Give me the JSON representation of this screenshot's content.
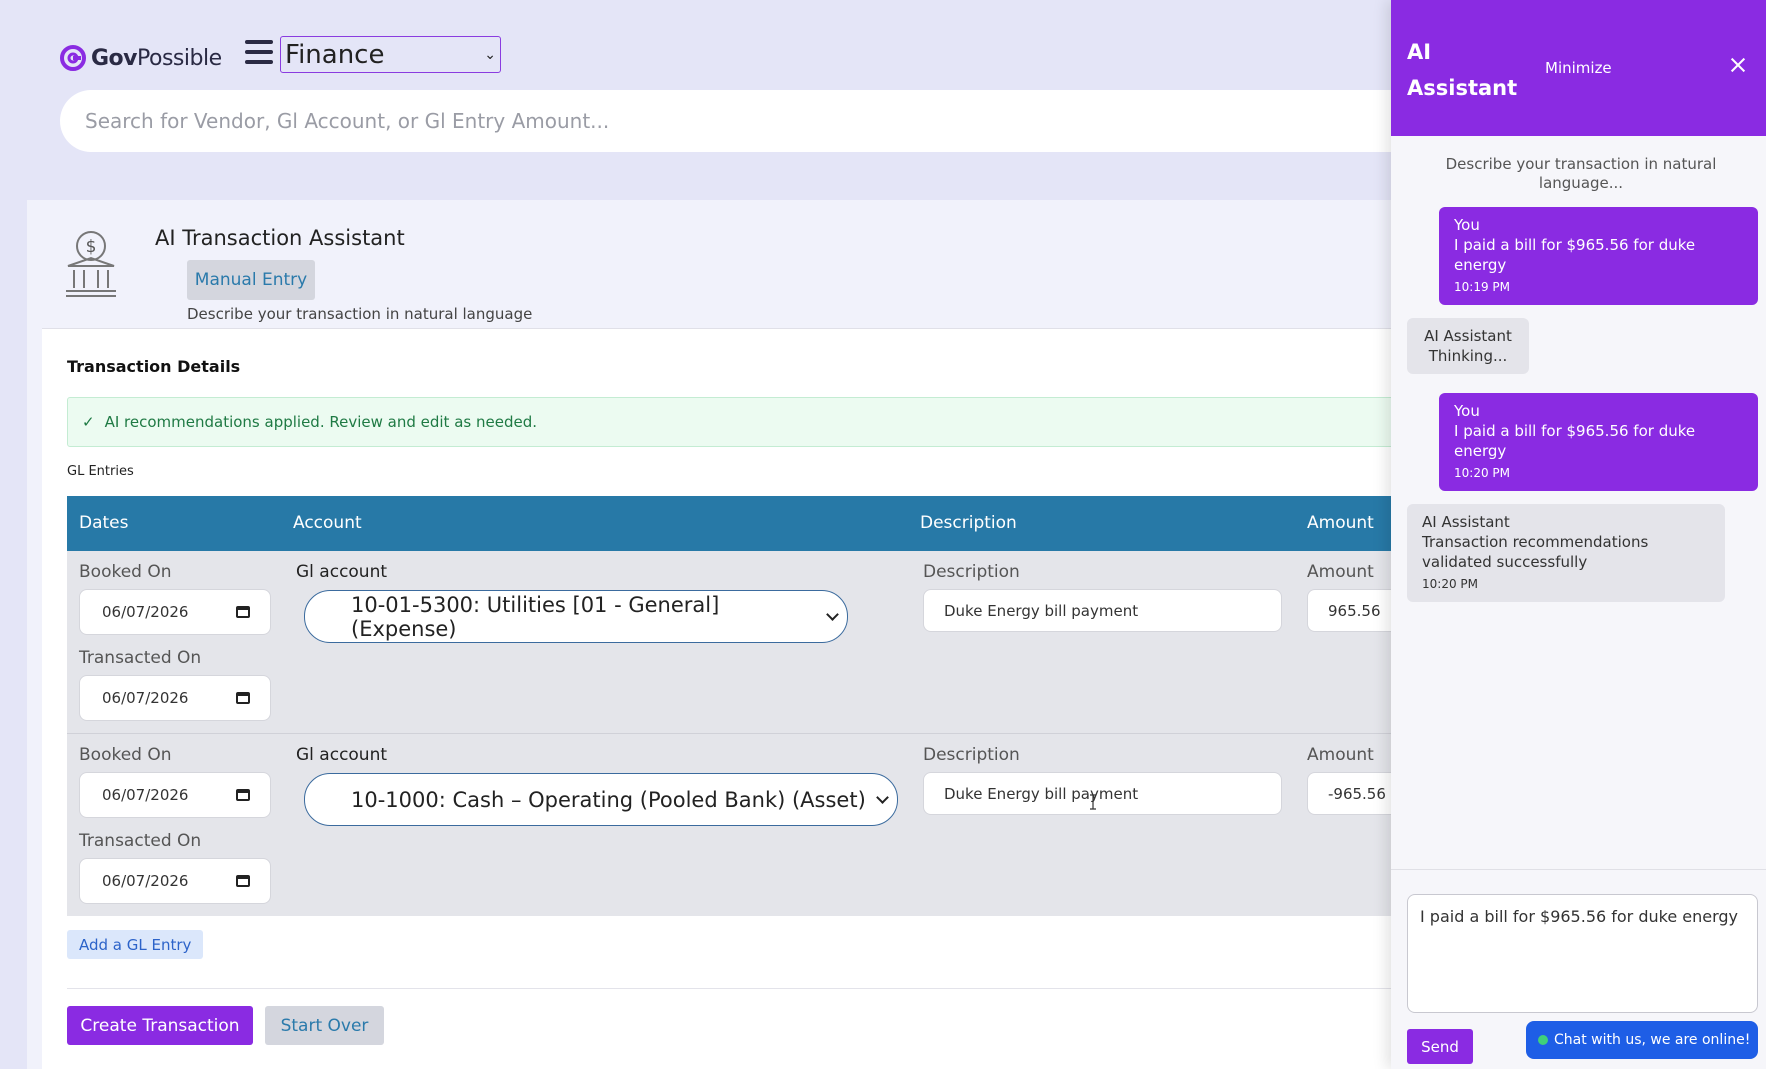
{
  "header": {
    "logo_bold": "Gov",
    "logo_light": "Possible",
    "module": "Finance",
    "search_placeholder": "Search for Vendor, Gl Account, or Gl Entry Amount..."
  },
  "page": {
    "title": "AI Transaction Assistant",
    "manual_entry_label": "Manual Entry",
    "subtitle": "Describe your transaction in natural language",
    "section_title": "Transaction Details",
    "alert_icon": "✓",
    "alert_text": "AI recommendations applied. Review and edit as needed.",
    "gl_label": "GL Entries",
    "columns": [
      "Dates",
      "Account",
      "Description",
      "Amount"
    ],
    "booked_on_label": "Booked On",
    "transacted_on_label": "Transacted On",
    "gl_account_label": "Gl account",
    "description_label": "Description",
    "amount_label": "Amount",
    "entries": [
      {
        "booked_on": "06/07/2026",
        "transacted_on": "06/07/2026",
        "account": "10-01-5300: Utilities [01 - General] (Expense)",
        "description": "Duke Energy bill payment",
        "amount": "965.56"
      },
      {
        "booked_on": "06/07/2026",
        "transacted_on": "06/07/2026",
        "account": "10-1000: Cash – Operating (Pooled Bank) (Asset)",
        "description": "Duke Energy bill payment",
        "amount": "-965.56"
      }
    ],
    "add_gl_label": "Add a GL Entry",
    "create_label": "Create Transaction",
    "start_over_label": "Start Over"
  },
  "ai": {
    "title": "AI Assistant",
    "minimize_label": "Minimize",
    "hint": "Describe your transaction in natural language...",
    "messages": [
      {
        "who": "You",
        "text": "I paid a bill for $965.56 for duke energy",
        "time": "10:19 PM"
      },
      {
        "who": "AI Assistant",
        "text": "Thinking..."
      },
      {
        "who": "You",
        "text": "I paid a bill for $965.56 for duke energy",
        "time": "10:20 PM"
      },
      {
        "who": "AI Assistant",
        "text": "Transaction recommendations validated successfully",
        "time": "10:20 PM"
      }
    ],
    "input_value": "I paid a bill for $965.56 for duke energy",
    "send_label": "Send",
    "chat_online_label": "Chat with us, we are online!"
  },
  "colors": {
    "accent_purple": "#8a2be2",
    "table_header_blue": "#2779a7",
    "page_bg": "#e4e5f7",
    "alert_green": "#1f7a44"
  }
}
